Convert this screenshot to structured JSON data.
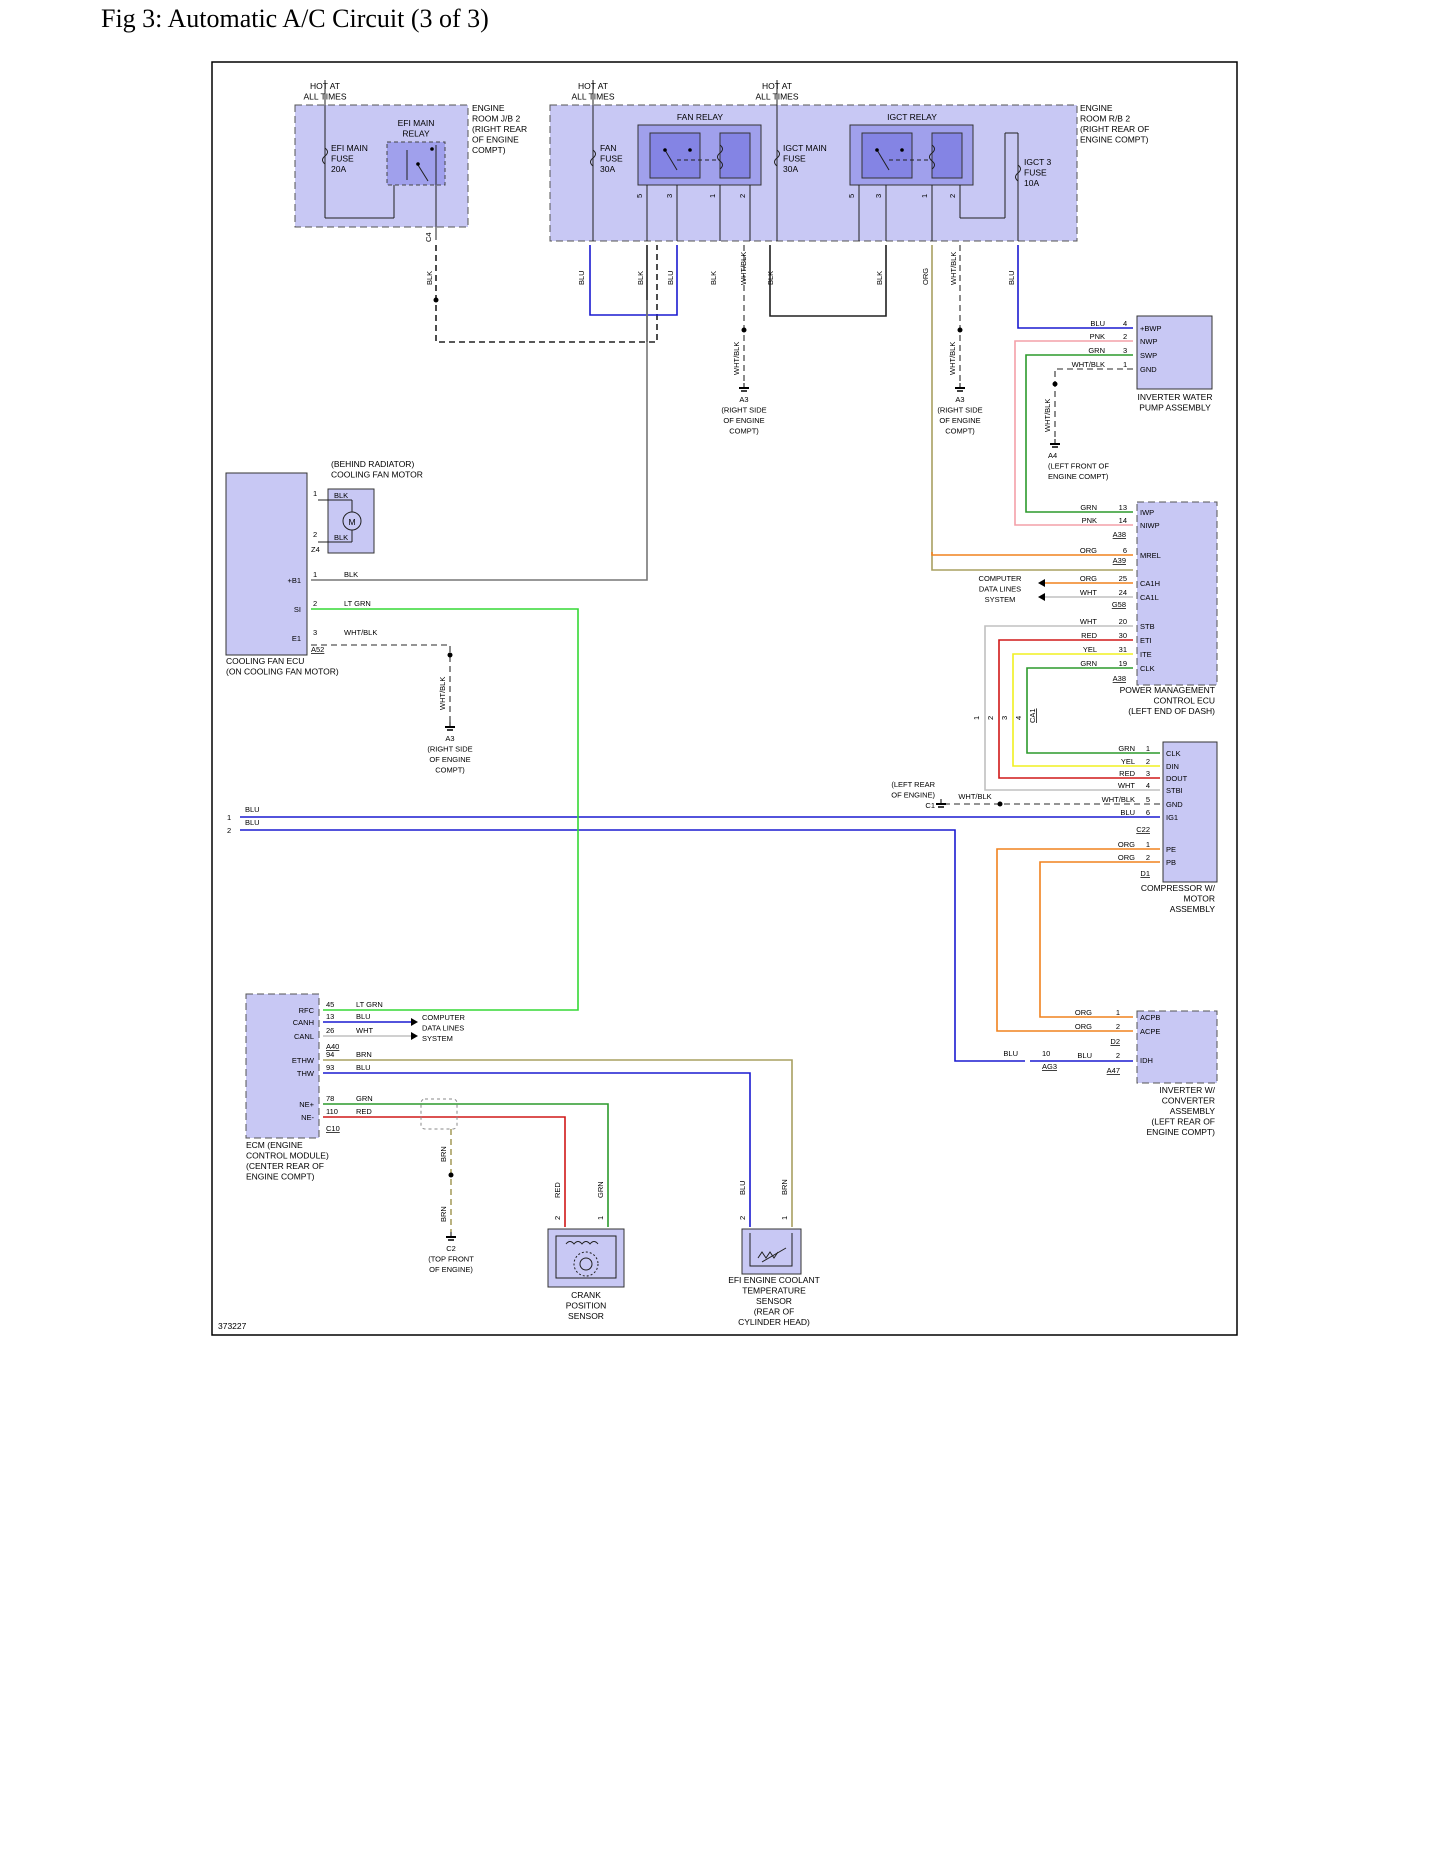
{
  "title": "Fig 3: Automatic A/C Circuit (3 of 3)",
  "figure_id": "373227",
  "colors": {
    "box_fill": "#c8c8f4",
    "box_dark": "#a0a0ec",
    "BLU": "#1a1ad0",
    "GRN": "#2c9a2c",
    "LT GRN": "#35d835",
    "RED": "#d01818",
    "ORG": "#f0821e",
    "YEL": "#f0f020",
    "PNK": "#f4a0a8",
    "BRN": "#a8a060",
    "WHT": "#c0c0c0",
    "BLK": "#202020",
    "WHT/BLK": "#707070"
  },
  "power": {
    "hot_at_all_times": "HOT AT\nALL TIMES"
  },
  "jb2": {
    "label": "ENGINE\nROOM J/B 2\n(RIGHT REAR\nOF ENGINE\nCOMPT)",
    "efi_main_fuse": "EFI MAIN\nFUSE\n20A",
    "efi_main_relay": "EFI MAIN\nRELAY",
    "connector": "C4"
  },
  "rb2": {
    "label": "ENGINE\nROOM R/B 2\n(RIGHT REAR OF\nENGINE COMPT)",
    "fan_fuse": "FAN\nFUSE\n30A",
    "igct_main_fuse": "IGCT MAIN\nFUSE\n30A",
    "igct3_fuse": "IGCT 3\nFUSE\n10A",
    "fan_relay": "FAN RELAY",
    "igct_relay": "IGCT RELAY",
    "pins": [
      "5",
      "3",
      "1",
      "2",
      "5",
      "3",
      "1",
      "2"
    ]
  },
  "top_wires": [
    "BLK",
    "BLU",
    "BLK",
    "BLU",
    "BLK",
    "WHT/BLK",
    "BLK",
    "BLK",
    "ORG",
    "WHT/BLK",
    "BLU"
  ],
  "grounds": {
    "a3_label": "A3\n(RIGHT SIDE\nOF ENGINE\nCOMPT)",
    "a4_label": "A4\n(LEFT FRONT OF\nENGINE COMPT)",
    "c2_label": "C2\n(TOP FRONT\nOF ENGINE)",
    "c1_label": "(LEFT REAR\nOF ENGINE)\nC1"
  },
  "wht_blk": "WHT/BLK",
  "brn": "BRN",
  "inverter_pump": {
    "label": "INVERTER WATER\nPUMP ASSEMBLY",
    "pins": [
      {
        "name": "+BWP",
        "wire": "BLU",
        "num": "4"
      },
      {
        "name": "NWP",
        "wire": "PNK",
        "num": "2"
      },
      {
        "name": "SWP",
        "wire": "GRN",
        "num": "3"
      },
      {
        "name": "GND",
        "wire": "WHT/BLK",
        "num": "1"
      }
    ]
  },
  "fan_motor": {
    "label": "(BEHIND RADIATOR)\nCOOLING FAN MOTOR",
    "pins": [
      "1",
      "2"
    ],
    "wire": "BLK",
    "connector": "Z4",
    "motor": "M"
  },
  "fan_ecu": {
    "label": "COOLING FAN ECU\n(ON COOLING FAN MOTOR)",
    "pins": [
      {
        "name": "+B1",
        "num": "1",
        "wire": "BLK"
      },
      {
        "name": "SI",
        "num": "2",
        "wire": "LT GRN"
      },
      {
        "name": "E1",
        "num": "3",
        "wire": "WHT/BLK"
      }
    ],
    "connector": "A52"
  },
  "pm_ecu": {
    "label": "POWER MANAGEMENT\nCONTROL ECU\n(LEFT END OF DASH)",
    "pins": [
      {
        "name": "IWP",
        "wire": "GRN",
        "num": "13"
      },
      {
        "name": "NIWP",
        "wire": "PNK",
        "num": "14"
      },
      {
        "name": "MREL",
        "wire": "ORG",
        "num": "6"
      },
      {
        "name": "CA1H",
        "wire": "ORG",
        "num": "25"
      },
      {
        "name": "CA1L",
        "wire": "WHT",
        "num": "24"
      },
      {
        "name": "STB",
        "wire": "WHT",
        "num": "20"
      },
      {
        "name": "ETI",
        "wire": "RED",
        "num": "30"
      },
      {
        "name": "ITE",
        "wire": "YEL",
        "num": "31"
      },
      {
        "name": "CLK",
        "wire": "GRN",
        "num": "19"
      }
    ],
    "connectors": [
      "A38",
      "A39",
      "G58",
      "A38"
    ]
  },
  "computer_data_lines": "COMPUTER\nDATA LINES\nSYSTEM",
  "ca1": {
    "connector": "CA1",
    "pins": [
      "1",
      "2",
      "3",
      "4"
    ]
  },
  "compressor": {
    "label": "COMPRESSOR W/\nMOTOR\nASSEMBLY",
    "pins": [
      {
        "name": "CLK",
        "wire": "GRN",
        "num": "1"
      },
      {
        "name": "DIN",
        "wire": "YEL",
        "num": "2"
      },
      {
        "name": "DOUT",
        "wire": "RED",
        "num": "3"
      },
      {
        "name": "STBI",
        "wire": "WHT",
        "num": "4"
      },
      {
        "name": "GND",
        "wire": "WHT/BLK",
        "num": "5"
      },
      {
        "name": "IG1",
        "wire": "BLU",
        "num": "6"
      }
    ],
    "connector_c": "C22",
    "pins2": [
      {
        "name": "PE",
        "wire": "ORG",
        "num": "1"
      },
      {
        "name": "PB",
        "wire": "ORG",
        "num": "2"
      }
    ],
    "connector_d": "D1"
  },
  "left_inputs": [
    {
      "num": "1",
      "wire": "BLU"
    },
    {
      "num": "2",
      "wire": "BLU"
    }
  ],
  "ecm": {
    "label": "ECM (ENGINE\nCONTROL MODULE)\n(CENTER REAR OF\nENGINE COMPT)",
    "pins": [
      {
        "name": "RFC",
        "num": "45",
        "wire": "LT GRN"
      },
      {
        "name": "CANH",
        "num": "13",
        "wire": "BLU"
      },
      {
        "name": "CANL",
        "num": "26",
        "wire": "WHT"
      },
      {
        "name": "ETHW",
        "num": "94",
        "wire": "BRN"
      },
      {
        "name": "THW",
        "num": "93",
        "wire": "BLU"
      },
      {
        "name": "NE+",
        "num": "78",
        "wire": "GRN"
      },
      {
        "name": "NE-",
        "num": "110",
        "wire": "RED"
      }
    ],
    "connectors": [
      "A40",
      "C10"
    ]
  },
  "inverter_conv": {
    "label": "INVERTER W/\nCONVERTER\nASSEMBLY\n(LEFT REAR OF\nENGINE COMPT)",
    "pins": [
      {
        "name": "ACPB",
        "wire": "ORG",
        "num": "1"
      },
      {
        "name": "ACPE",
        "wire": "ORG",
        "num": "2"
      },
      {
        "name": "IDH",
        "wire": "BLU",
        "num": "2"
      }
    ],
    "connectors": [
      "D2",
      "A47"
    ],
    "ag3": {
      "wire": "BLU",
      "num": "10",
      "connector": "AG3"
    }
  },
  "crank": {
    "label": "CRANK\nPOSITION\nSENSOR",
    "wires": [
      "RED",
      "GRN"
    ],
    "pins": [
      "2",
      "1"
    ]
  },
  "coolant": {
    "label": "EFI ENGINE COOLANT\nTEMPERATURE\nSENSOR\n(REAR OF\nCYLINDER HEAD)",
    "wires": [
      "BLU",
      "BRN"
    ],
    "pins": [
      "2",
      "1"
    ]
  }
}
